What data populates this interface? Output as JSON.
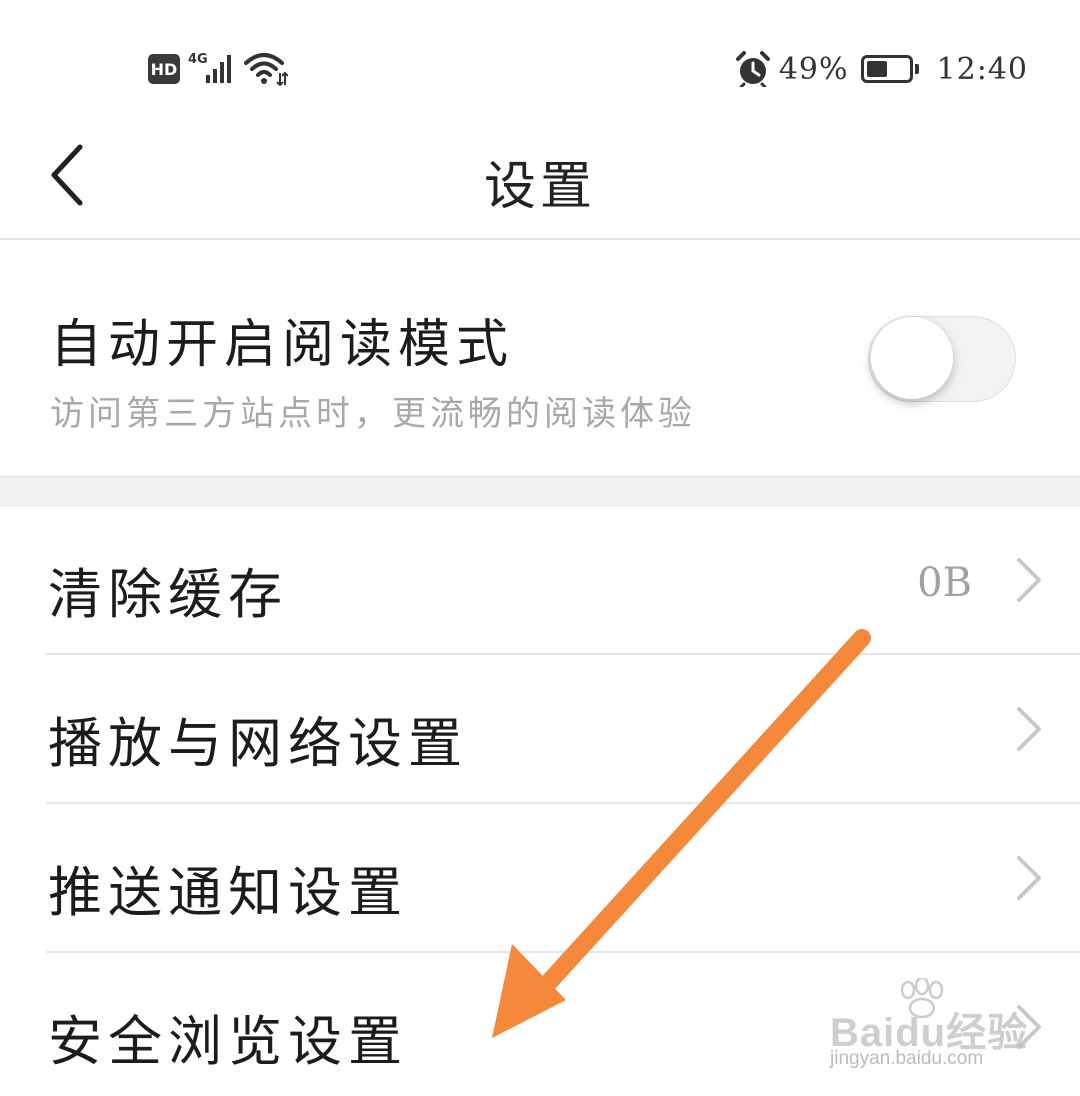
{
  "status_bar": {
    "hd_badge": "HD",
    "network": "4G",
    "battery_text": "49%",
    "battery_level": 0.49,
    "time": "12:40",
    "icons": [
      "hd-icon",
      "signal-icon",
      "wifi-icon",
      "alarm-icon",
      "battery-icon"
    ]
  },
  "header": {
    "title": "设置",
    "back_icon": "chevron-left-icon"
  },
  "reading_mode": {
    "title": "自动开启阅读模式",
    "subtitle": "访问第三方站点时，更流畅的阅读体验",
    "enabled": false
  },
  "settings": [
    {
      "label": "清除缓存",
      "value": "0B"
    },
    {
      "label": "播放与网络设置",
      "value": ""
    },
    {
      "label": "推送通知设置",
      "value": ""
    },
    {
      "label": "安全浏览设置",
      "value": ""
    }
  ],
  "annotation": {
    "color": "#f5883a"
  },
  "watermark": {
    "brand": "Baidu经验",
    "url": "jingyan.baidu.com"
  },
  "colors": {
    "text_primary": "#1c1c1c",
    "text_secondary": "#a8a8a8",
    "divider": "#e6e6e6",
    "section_gap": "#f2f2f2"
  }
}
